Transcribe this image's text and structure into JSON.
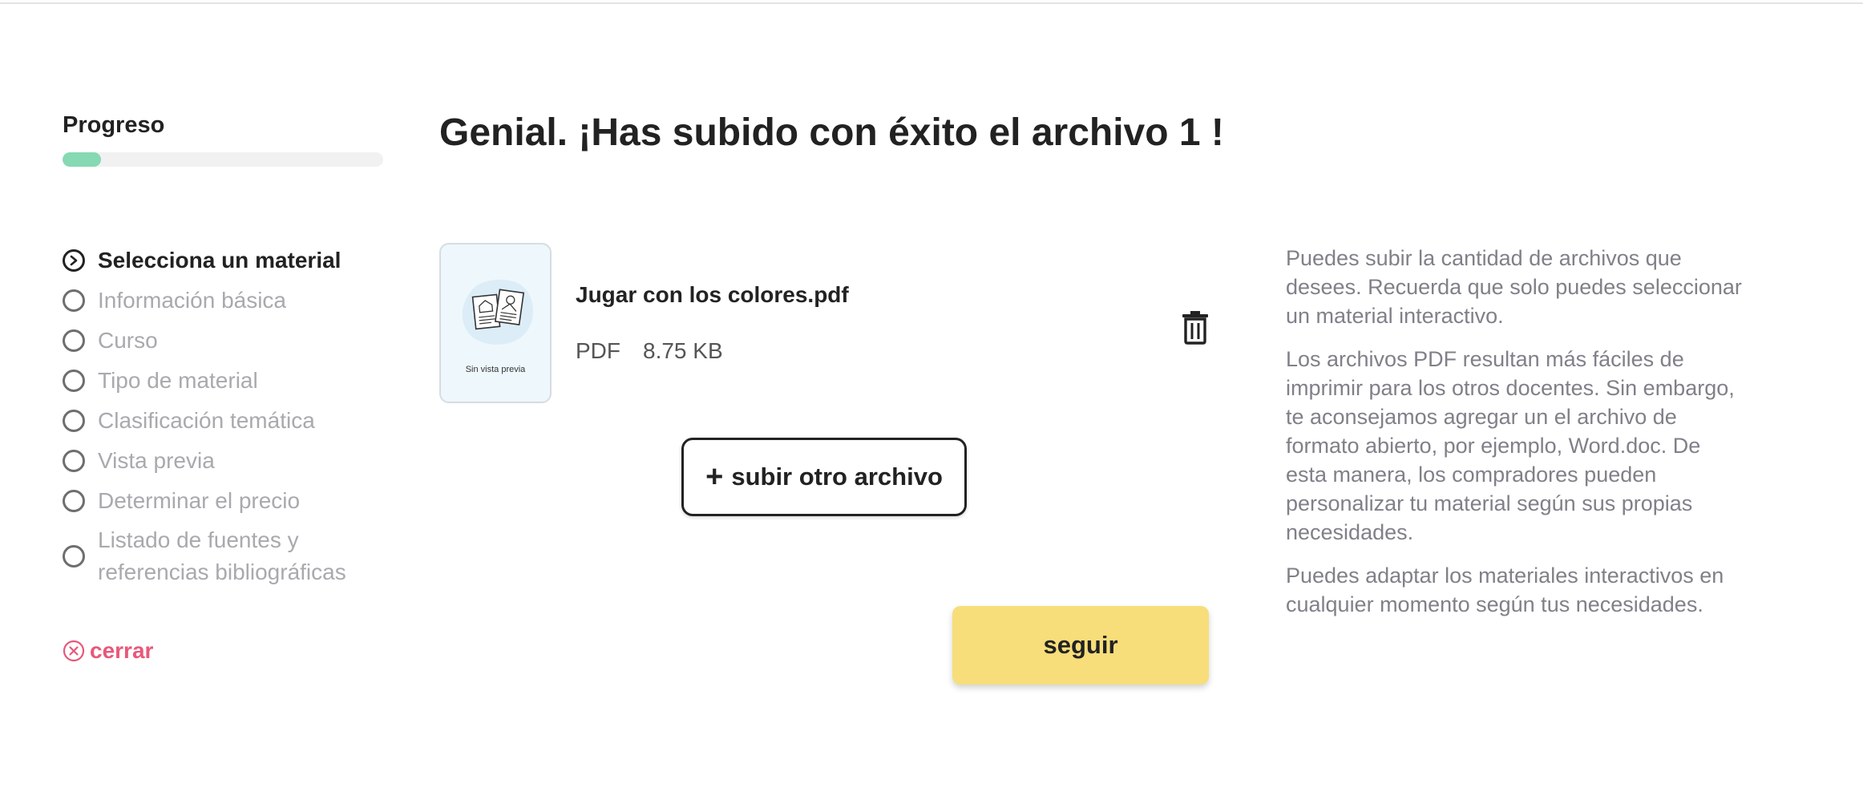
{
  "sidebar": {
    "progress_title": "Progreso",
    "progress_fraction": 0.12,
    "progress_color": "#86d9b2",
    "steps": [
      {
        "label": "Selecciona un material",
        "active": true
      },
      {
        "label": "Información básica",
        "active": false
      },
      {
        "label": "Curso",
        "active": false
      },
      {
        "label": "Tipo de material",
        "active": false
      },
      {
        "label": "Clasificación temática",
        "active": false
      },
      {
        "label": "Vista previa",
        "active": false
      },
      {
        "label": "Determinar el precio",
        "active": false
      },
      {
        "label": "Listado de fuentes y referencias bibliográficas",
        "active": false
      }
    ],
    "close_label": "cerrar",
    "close_color": "#e8587a"
  },
  "main": {
    "headline": "Genial. ¡Has subido con éxito el archivo 1 !",
    "file": {
      "preview_caption": "Sin vista previa",
      "name": "Jugar con los colores.pdf",
      "type": "PDF",
      "size": "8.75 KB"
    },
    "upload_another_label": "subir otro archivo",
    "continue_label": "seguir",
    "continue_color": "#f7de7a"
  },
  "help": {
    "paragraphs": [
      "Puedes subir la cantidad de archivos que desees. Recuerda que solo puedes seleccionar un material interactivo.",
      "Los archivos PDF resultan más fáciles de imprimir para los otros docentes. Sin embargo, te aconsejamos agregar un el archivo de formato abierto, por ejemplo, Word.doc. De esta manera, los compradores pueden personalizar tu material según sus propias necesidades.",
      "Puedes adaptar los materiales interactivos en cualquier momento según tus necesidades."
    ]
  }
}
